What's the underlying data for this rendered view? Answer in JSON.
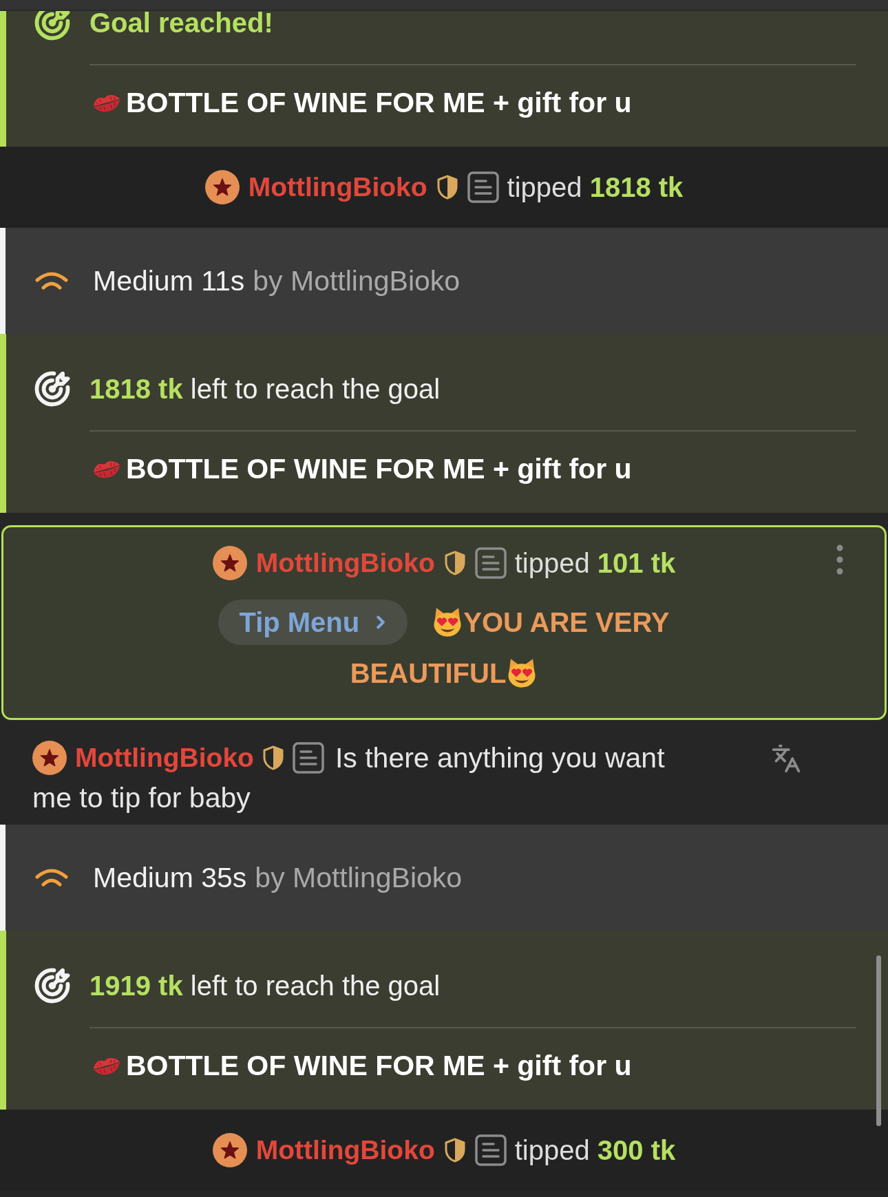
{
  "feed": [
    {
      "kind": "goal",
      "reached": true,
      "status": "Goal reached!",
      "goal": "BOTTLE OF WINE FOR ME + gift for u"
    },
    {
      "kind": "tip",
      "highlighted": false,
      "user": "MottlingBioko",
      "text": "tipped **1818 tk**"
    },
    {
      "kind": "vibration",
      "strength": "Medium 11s",
      "by": "by MottlingBioko"
    },
    {
      "kind": "goal",
      "reached": false,
      "status": "**1818 tk** left to reach the goal",
      "goal": "BOTTLE OF WINE FOR ME + gift for u"
    },
    {
      "kind": "tip",
      "highlighted": true,
      "user": "MottlingBioko",
      "text": "tipped **101 tk**",
      "menu_button": "Tip Menu",
      "message_lines": [
        "YOU ARE VERY",
        "BEAUTIFUL"
      ]
    },
    {
      "kind": "chat",
      "user": "MottlingBioko",
      "message_lines": [
        "Is there anything you want",
        "me to tip for baby"
      ]
    },
    {
      "kind": "vibration",
      "strength": "Medium 35s",
      "by": "by MottlingBioko"
    },
    {
      "kind": "goal",
      "reached": false,
      "status": "**1919 tk** left to reach the goal",
      "goal": "BOTTLE OF WINE FOR ME + gift for u"
    },
    {
      "kind": "tip",
      "highlighted": false,
      "user": "MottlingBioko",
      "text": "tipped **300 tk**"
    }
  ]
}
